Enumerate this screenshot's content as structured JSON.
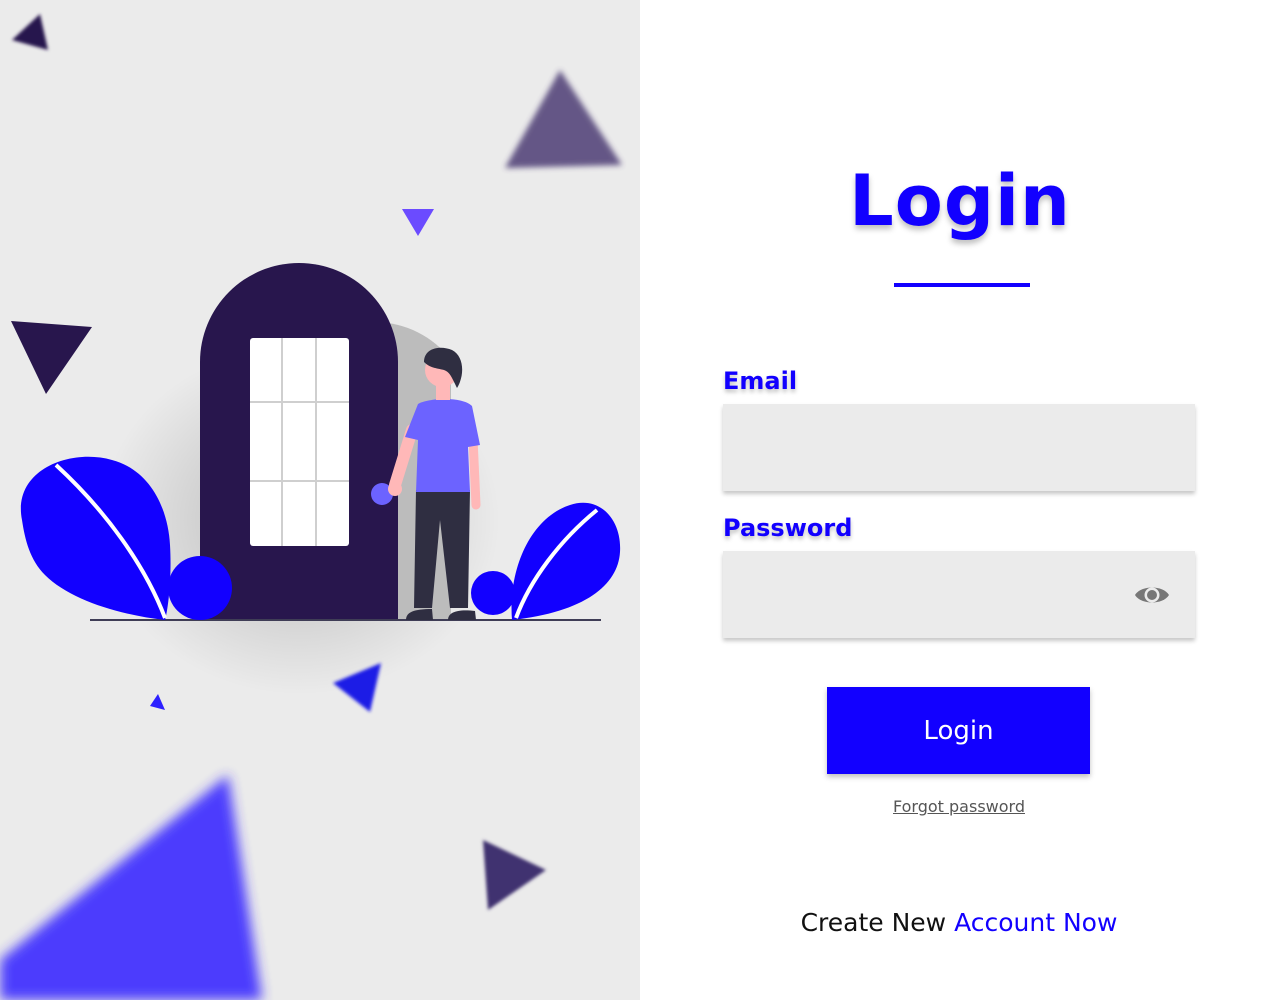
{
  "login_form": {
    "title": "Login",
    "email_label": "Email",
    "email_value": "",
    "password_label": "Password",
    "password_value": "",
    "password_toggle_icon": "eye-icon",
    "submit_label": "Login",
    "forgot_password_label": "Forgot password",
    "create_account_prefix": "Create New",
    "create_account_link": "Account Now"
  },
  "illustration": {
    "description_icon": "person-at-door-illustration"
  },
  "colors": {
    "accent": "#1200ff",
    "dark_door": "#28164d",
    "panel_bg": "#ebebeb",
    "shirt": "#6c63ff"
  }
}
